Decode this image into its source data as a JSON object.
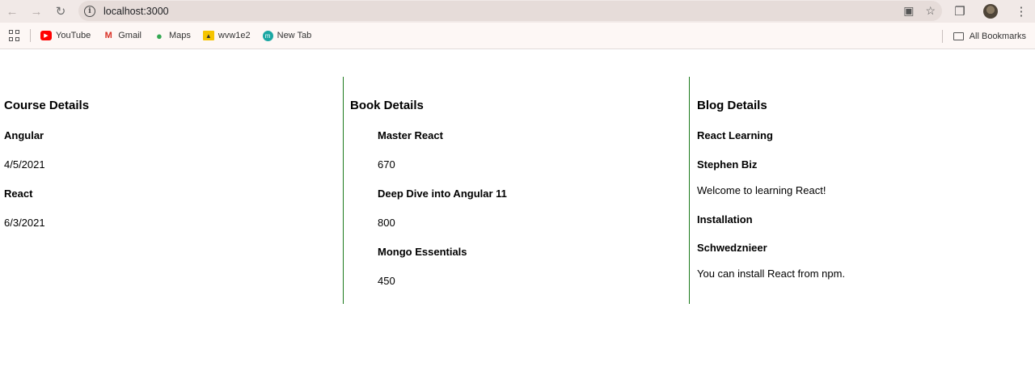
{
  "browser": {
    "url": "localhost:3000",
    "bookmarks": [
      {
        "label": "YouTube",
        "icon": "youtube-icon"
      },
      {
        "label": "Gmail",
        "icon": "gmail-icon"
      },
      {
        "label": "Maps",
        "icon": "maps-icon"
      },
      {
        "label": "wvw1e2",
        "icon": "bookmark-site-icon"
      },
      {
        "label": "New Tab",
        "icon": "new-tab-icon"
      }
    ],
    "all_bookmarks_label": "All Bookmarks"
  },
  "course": {
    "heading": "Course Details",
    "items": [
      {
        "name": "Angular",
        "date": "4/5/2021"
      },
      {
        "name": "React",
        "date": "6/3/2021"
      }
    ]
  },
  "book": {
    "heading": "Book Details",
    "items": [
      {
        "name": "Master React",
        "price": "670"
      },
      {
        "name": "Deep Dive into Angular 11",
        "price": "800"
      },
      {
        "name": "Mongo Essentials",
        "price": "450"
      }
    ]
  },
  "blog": {
    "heading": "Blog Details",
    "items": [
      {
        "title": "React Learning",
        "author": "Stephen Biz",
        "content": "Welcome to learning React!"
      },
      {
        "title": "Installation",
        "author": "Schwedznieer",
        "content": "You can install React from npm."
      }
    ]
  },
  "colors": {
    "divider": "#1b7a1b",
    "toolbar_bg": "#f1e9e7"
  }
}
